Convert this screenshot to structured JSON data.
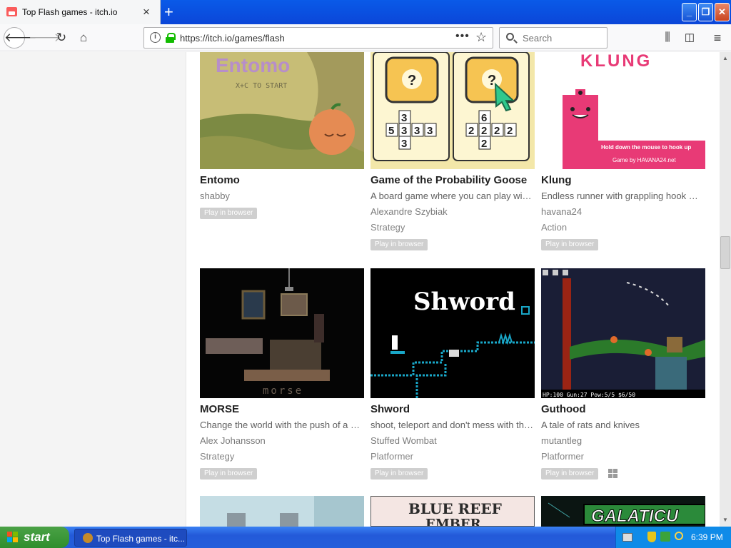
{
  "browser": {
    "tab_title": "Top Flash games - itch.io",
    "tab_close": "×",
    "new_tab": "+",
    "url": "https://itch.io/games/flash",
    "search_placeholder": "Search",
    "more_dots": "•••",
    "star": "☆"
  },
  "window_controls": {
    "minimize": "_",
    "restore": "❐",
    "close": "✕"
  },
  "games_row1": [
    {
      "title": "Entomo",
      "description": "",
      "author": "shabby",
      "genre": "",
      "badge": "Play in browser"
    },
    {
      "title": "Game of the Probability Goose",
      "description": "A board game where you can play with the dice",
      "author": "Alexandre Szybiak",
      "genre": "Strategy",
      "badge": "Play in browser"
    },
    {
      "title": "Klung",
      "description": "Endless runner with grappling hook mechanic",
      "author": "havana24",
      "genre": "Action",
      "badge": "Play in browser"
    }
  ],
  "games_row2": [
    {
      "title": "MORSE",
      "description": "Change the world with the push of a button",
      "author": "Alex Johansson",
      "genre": "Strategy",
      "badge": "Play in browser"
    },
    {
      "title": "Shword",
      "description": "shoot, teleport and don't mess with the shword",
      "author": "Stuffed Wombat",
      "genre": "Platformer",
      "badge": "Play in browser"
    },
    {
      "title": "Guthood",
      "description": "A tale of rats and knives",
      "author": "mutantleg",
      "genre": "Platformer",
      "badge": "Play in browser"
    }
  ],
  "thumbnails": {
    "entomo_logo": "Entomo",
    "entomo_sub": "X+C TO START",
    "klung_logo": "KLUNG",
    "klung_hint": "Hold down the mouse to hook up",
    "klung_credit": "Game by HAVANA24.net",
    "shword_logo": "Shword",
    "morse_logo": "morse",
    "guthood_hud": "HP:100   Gun:27   Pow:5/5   $6/50",
    "row3_b": "BLUE REEF",
    "row3_b2": "EMBER",
    "row3_c": "GALATICU"
  },
  "taskbar": {
    "start_label": "start",
    "task_item": "Top Flash games - itc...",
    "clock": "6:39 PM"
  },
  "colors": {
    "titlebar": "#0b46d8",
    "badge": "#cfcfcf",
    "klung_pink": "#e83a76",
    "taskbar": "#245edb",
    "start_green": "#3a9a36"
  }
}
